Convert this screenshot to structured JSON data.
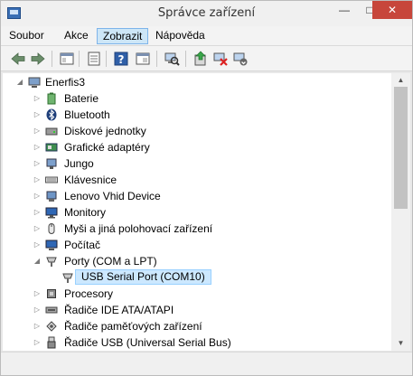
{
  "window": {
    "title": "Správce zařízení"
  },
  "menu": {
    "items": [
      "Soubor",
      "Akce",
      "Zobrazit",
      "Nápověda"
    ]
  },
  "toolbar": {
    "buttons": [
      "back-arrow-icon",
      "forward-arrow-icon",
      "show-hide-tree-icon",
      "properties-icon",
      "help-icon",
      "view-icon",
      "scan-hardware-icon",
      "update-driver-icon",
      "disable-device-icon",
      "uninstall-device-icon"
    ]
  },
  "tree": {
    "root": "Enerfis3",
    "items": [
      {
        "label": "Baterie",
        "expander": "collapsed"
      },
      {
        "label": "Bluetooth",
        "expander": "collapsed"
      },
      {
        "label": "Diskové jednotky",
        "expander": "collapsed"
      },
      {
        "label": "Grafické adaptéry",
        "expander": "collapsed"
      },
      {
        "label": "Jungo",
        "expander": "collapsed"
      },
      {
        "label": "Klávesnice",
        "expander": "collapsed"
      },
      {
        "label": "Lenovo Vhid Device",
        "expander": "collapsed"
      },
      {
        "label": "Monitory",
        "expander": "collapsed"
      },
      {
        "label": "Myši a jiná polohovací zařízení",
        "expander": "collapsed"
      },
      {
        "label": "Počítač",
        "expander": "collapsed"
      },
      {
        "label": "Porty (COM a LPT)",
        "expander": "expanded"
      },
      {
        "label": "USB Serial Port (COM10)",
        "child": true,
        "selected": true
      },
      {
        "label": "Procesory",
        "expander": "collapsed"
      },
      {
        "label": "Řadiče IDE ATA/ATAPI",
        "expander": "collapsed"
      },
      {
        "label": "Řadiče paměťových zařízení",
        "expander": "collapsed"
      },
      {
        "label": "Řadiče USB (Universal Serial Bus)",
        "expander": "collapsed"
      }
    ]
  },
  "colors": {
    "selection": "#cce8ff",
    "menu_highlight": "#cde6f7",
    "close_button": "#c7463b"
  }
}
